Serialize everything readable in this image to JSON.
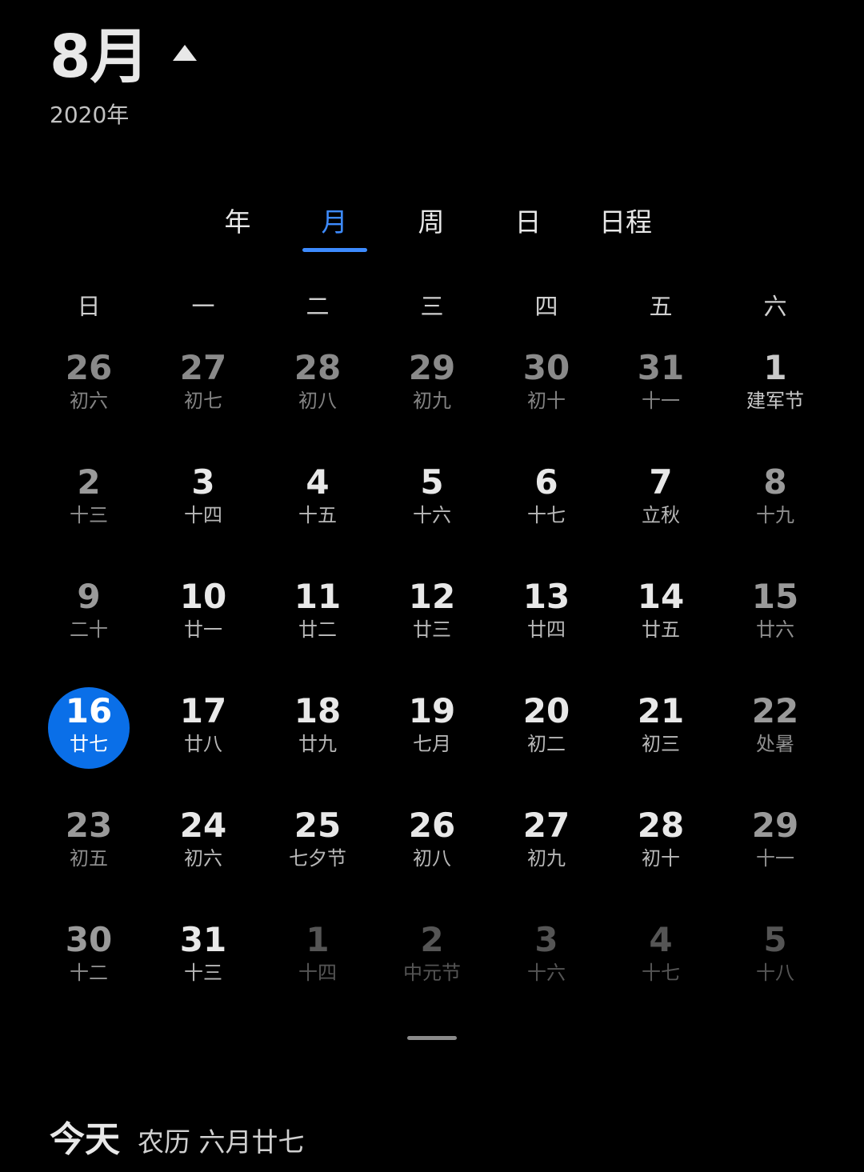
{
  "header": {
    "month": "8月",
    "year": "2020年"
  },
  "tabs": [
    {
      "label": "年",
      "active": false
    },
    {
      "label": "月",
      "active": true
    },
    {
      "label": "周",
      "active": false
    },
    {
      "label": "日",
      "active": false
    },
    {
      "label": "日程",
      "active": false
    }
  ],
  "weekdays": [
    "日",
    "一",
    "二",
    "三",
    "四",
    "五",
    "六"
  ],
  "weeks": [
    [
      {
        "day": "26",
        "lunar": "初六",
        "style": "dim"
      },
      {
        "day": "27",
        "lunar": "初七",
        "style": "dim"
      },
      {
        "day": "28",
        "lunar": "初八",
        "style": "dim"
      },
      {
        "day": "29",
        "lunar": "初九",
        "style": "dim"
      },
      {
        "day": "30",
        "lunar": "初十",
        "style": "dim"
      },
      {
        "day": "31",
        "lunar": "十一",
        "style": "dim"
      },
      {
        "day": "1",
        "lunar": "建军节",
        "style": "first"
      }
    ],
    [
      {
        "day": "2",
        "lunar": "十三",
        "style": "weekend"
      },
      {
        "day": "3",
        "lunar": "十四",
        "style": "bright"
      },
      {
        "day": "4",
        "lunar": "十五",
        "style": "bright"
      },
      {
        "day": "5",
        "lunar": "十六",
        "style": "bright"
      },
      {
        "day": "6",
        "lunar": "十七",
        "style": "bright"
      },
      {
        "day": "7",
        "lunar": "立秋",
        "style": "bright"
      },
      {
        "day": "8",
        "lunar": "十九",
        "style": "weekend"
      }
    ],
    [
      {
        "day": "9",
        "lunar": "二十",
        "style": "weekend"
      },
      {
        "day": "10",
        "lunar": "廿一",
        "style": "bright"
      },
      {
        "day": "11",
        "lunar": "廿二",
        "style": "bright"
      },
      {
        "day": "12",
        "lunar": "廿三",
        "style": "bright"
      },
      {
        "day": "13",
        "lunar": "廿四",
        "style": "bright"
      },
      {
        "day": "14",
        "lunar": "廿五",
        "style": "bright"
      },
      {
        "day": "15",
        "lunar": "廿六",
        "style": "weekend"
      }
    ],
    [
      {
        "day": "16",
        "lunar": "廿七",
        "style": "today"
      },
      {
        "day": "17",
        "lunar": "廿八",
        "style": "bright"
      },
      {
        "day": "18",
        "lunar": "廿九",
        "style": "bright"
      },
      {
        "day": "19",
        "lunar": "七月",
        "style": "bright"
      },
      {
        "day": "20",
        "lunar": "初二",
        "style": "bright"
      },
      {
        "day": "21",
        "lunar": "初三",
        "style": "bright"
      },
      {
        "day": "22",
        "lunar": "处暑",
        "style": "weekend"
      }
    ],
    [
      {
        "day": "23",
        "lunar": "初五",
        "style": "weekend"
      },
      {
        "day": "24",
        "lunar": "初六",
        "style": "bright"
      },
      {
        "day": "25",
        "lunar": "七夕节",
        "style": "bright"
      },
      {
        "day": "26",
        "lunar": "初八",
        "style": "bright"
      },
      {
        "day": "27",
        "lunar": "初九",
        "style": "bright"
      },
      {
        "day": "28",
        "lunar": "初十",
        "style": "bright"
      },
      {
        "day": "29",
        "lunar": "十一",
        "style": "weekend"
      }
    ],
    [
      {
        "day": "30",
        "lunar": "十二",
        "style": "weekend"
      },
      {
        "day": "31",
        "lunar": "十三",
        "style": "bright"
      },
      {
        "day": "1",
        "lunar": "十四",
        "style": "faint"
      },
      {
        "day": "2",
        "lunar": "中元节",
        "style": "faint"
      },
      {
        "day": "3",
        "lunar": "十六",
        "style": "faint"
      },
      {
        "day": "4",
        "lunar": "十七",
        "style": "faint"
      },
      {
        "day": "5",
        "lunar": "十八",
        "style": "faint"
      }
    ]
  ],
  "footer": {
    "today_label": "今天",
    "lunar_date": "农历 六月廿七"
  },
  "colors": {
    "accent": "#3d8bff",
    "today_circle": "#0a6fe8",
    "background": "#000000"
  }
}
